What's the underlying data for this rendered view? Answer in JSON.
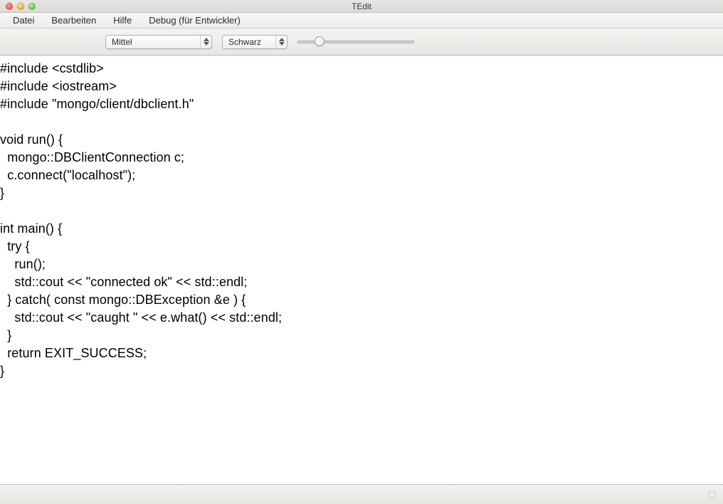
{
  "window": {
    "title": "TEdit"
  },
  "menubar": {
    "items": [
      "Datei",
      "Bearbeiten",
      "Hilfe",
      "Debug (für Entwickler)"
    ]
  },
  "toolbar": {
    "size_select": {
      "value": "Mittel"
    },
    "color_select": {
      "value": "Schwarz"
    },
    "slider": {
      "value": 16,
      "min": 0,
      "max": 100
    }
  },
  "editor": {
    "content": "#include <cstdlib>\n#include <iostream>\n#include \"mongo/client/dbclient.h\"\n\nvoid run() {\n  mongo::DBClientConnection c;\n  c.connect(\"localhost\");\n}\n\nint main() {\n  try {\n    run();\n    std::cout << \"connected ok\" << std::endl;\n  } catch( const mongo::DBException &e ) {\n    std::cout << \"caught \" << e.what() << std::endl;\n  }\n  return EXIT_SUCCESS;\n}"
  }
}
